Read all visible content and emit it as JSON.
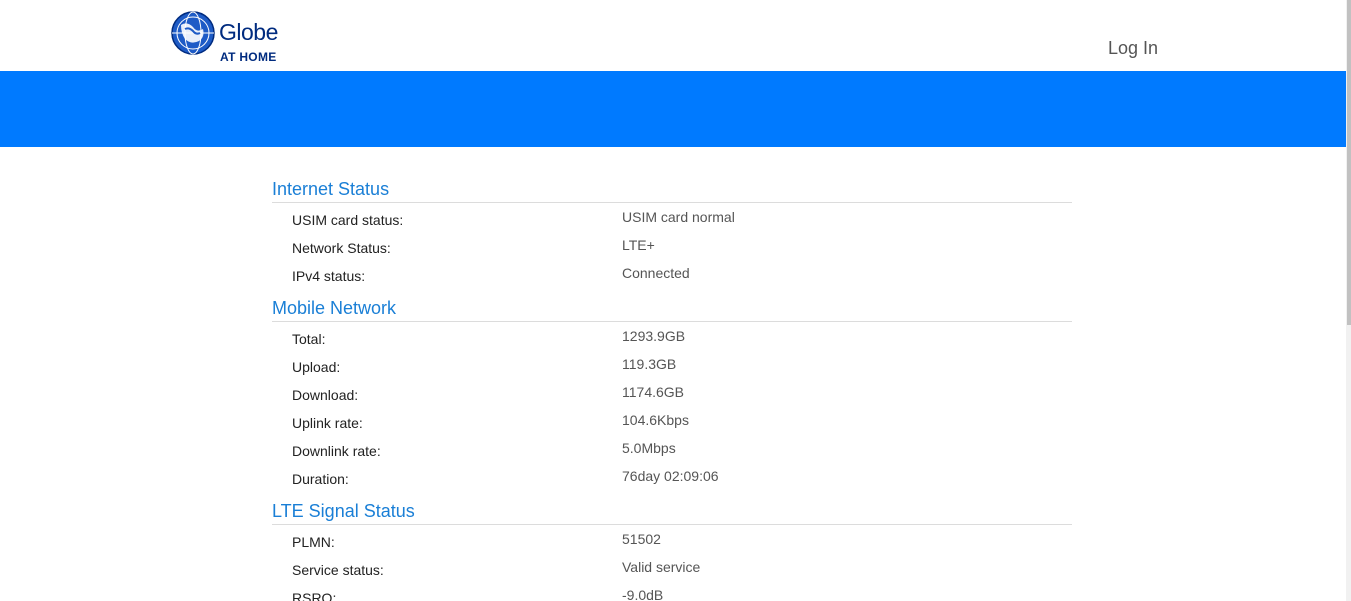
{
  "header": {
    "logo_name": "Globe",
    "logo_sub": "AT HOME",
    "login_label": "Log In"
  },
  "colors": {
    "brand_blue": "#007aff",
    "section_title": "#1a7fd6",
    "logo_navy": "#002b7f"
  },
  "sections": [
    {
      "title": "Internet Status",
      "rows": [
        {
          "label": "USIM card status:",
          "value": "USIM card normal"
        },
        {
          "label": "Network Status:",
          "value": "LTE+"
        },
        {
          "label": "IPv4 status:",
          "value": "Connected"
        }
      ]
    },
    {
      "title": "Mobile Network",
      "rows": [
        {
          "label": "Total:",
          "value": "1293.9GB"
        },
        {
          "label": "Upload:",
          "value": "119.3GB"
        },
        {
          "label": "Download:",
          "value": "1174.6GB"
        },
        {
          "label": "Uplink rate:",
          "value": "104.6Kbps"
        },
        {
          "label": "Downlink rate:",
          "value": "5.0Mbps"
        },
        {
          "label": "Duration:",
          "value": "76day 02:09:06"
        }
      ]
    },
    {
      "title": "LTE Signal Status",
      "rows": [
        {
          "label": "PLMN:",
          "value": "51502"
        },
        {
          "label": "Service status:",
          "value": "Valid service"
        },
        {
          "label": "RSRQ:",
          "value": "-9.0dB"
        }
      ]
    }
  ]
}
